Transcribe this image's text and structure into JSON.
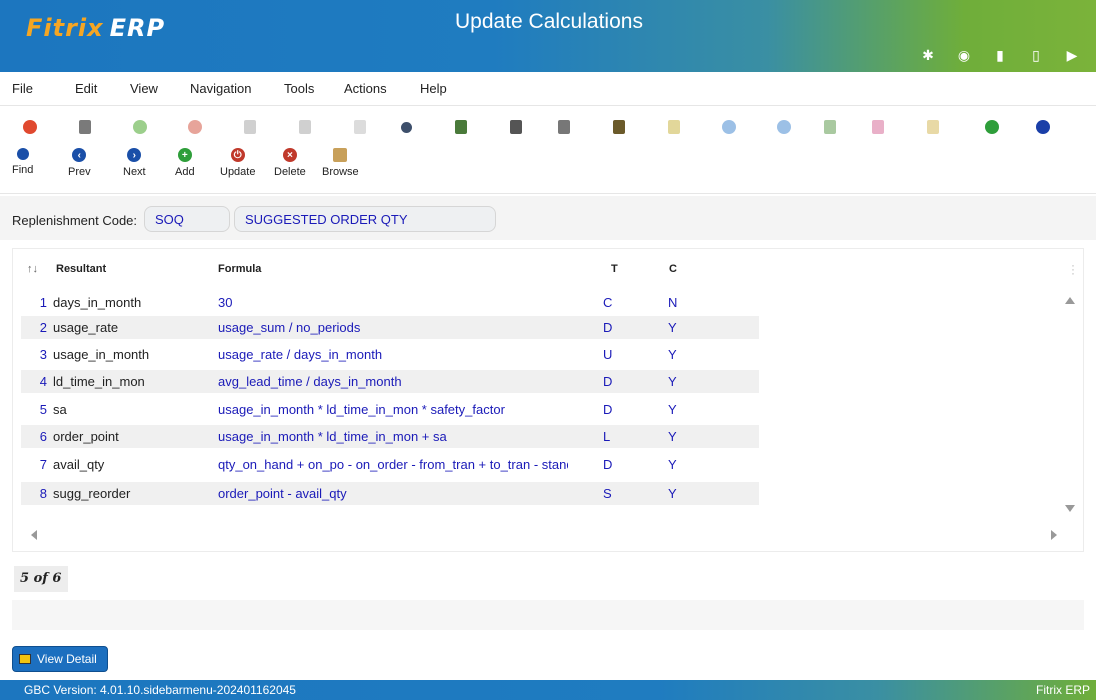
{
  "app": {
    "logo_main": "Fitrix",
    "logo_sub": "ERP",
    "title": "Update Calculations"
  },
  "header_icons": [
    "gear-icon",
    "chip-icon",
    "document-icon",
    "new-document-icon",
    "play-icon"
  ],
  "menu": [
    "File",
    "Edit",
    "View",
    "Navigation",
    "Tools",
    "Actions",
    "Help"
  ],
  "toolbar2": [
    {
      "label": "Find",
      "icon": "search-icon",
      "color": "#1a4fa8"
    },
    {
      "label": "Prev",
      "icon": "prev-icon",
      "color": "#1a4fa8"
    },
    {
      "label": "Next",
      "icon": "next-icon",
      "color": "#1a4fa8"
    },
    {
      "label": "Add",
      "icon": "add-icon",
      "color": "#2e9e3a"
    },
    {
      "label": "Update",
      "icon": "power-icon",
      "color": "#c0392b"
    },
    {
      "label": "Delete",
      "icon": "delete-icon",
      "color": "#c0392b"
    },
    {
      "label": "Browse",
      "icon": "folder-icon",
      "color": "#c8a05a"
    }
  ],
  "form": {
    "label": "Replenishment Code:",
    "code": "SOQ",
    "description": "SUGGESTED ORDER QTY"
  },
  "table": {
    "headers": {
      "sort": "↑↓",
      "resultant": "Resultant",
      "formula": "Formula",
      "t": "T",
      "c": "C"
    },
    "rows": [
      {
        "idx": "1",
        "resultant": "days_in_month",
        "formula": "30",
        "t": "C",
        "c": "N"
      },
      {
        "idx": "2",
        "resultant": "usage_rate",
        "formula": "usage_sum / no_periods",
        "t": "D",
        "c": "Y"
      },
      {
        "idx": "3",
        "resultant": "usage_in_month",
        "formula": "usage_rate / days_in_month",
        "t": "U",
        "c": "Y"
      },
      {
        "idx": "4",
        "resultant": "ld_time_in_mon",
        "formula": "avg_lead_time / days_in_month",
        "t": "D",
        "c": "Y"
      },
      {
        "idx": "5",
        "resultant": "sa",
        "formula": "usage_in_month * ld_time_in_mon * safety_factor",
        "t": "D",
        "c": "Y"
      },
      {
        "idx": "6",
        "resultant": "order_point",
        "formula": "usage_in_month * ld_time_in_mon + sa",
        "t": "L",
        "c": "Y"
      },
      {
        "idx": "7",
        "resultant": "avail_qty",
        "formula": "qty_on_hand + on_po - on_order - from_tran + to_tran - standing_",
        "t": "D",
        "c": "Y"
      },
      {
        "idx": "8",
        "resultant": "sugg_reorder",
        "formula": "order_point - avail_qty",
        "t": "S",
        "c": "Y"
      }
    ]
  },
  "record_count": "5 of 6",
  "view_detail": "View Detail",
  "status": {
    "version": "GBC Version: 4.01.10.sidebarmenu-202401162045",
    "brand": "Fitrix ERP"
  }
}
